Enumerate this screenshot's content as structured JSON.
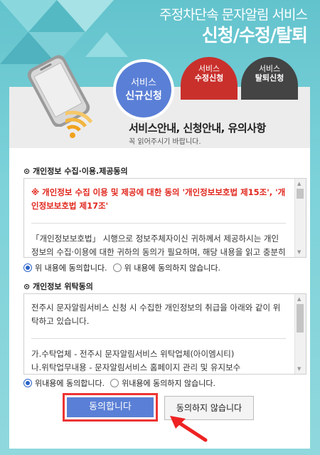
{
  "header": {
    "title1": "주정차단속 문자알림 서비스",
    "title2": "신청/수정/탈퇴"
  },
  "tabs": {
    "new": {
      "line1": "서비스",
      "line2": "신규신청"
    },
    "modify": {
      "line1": "서비스",
      "line2": "수정신청"
    },
    "withdraw": {
      "line1": "서비스",
      "line2": "탈퇴신청"
    }
  },
  "intro": {
    "title": "서비스안내, 신청안내, 유의사항",
    "note": "꼭 읽어주시기 바랍니다."
  },
  "section1": {
    "title": "⊙ 개인정보 수집·이용.제공동의",
    "highlight": "※ 개인정보 수집 이용 및 제공에 대한 동의 '개인정보보호법 제15조', '개인정보보호법 제17조'",
    "body": "「개인정보보호법」 시행으로 정보주체자이신 귀하께서 제공하시는 개인정보의 수집·이용에 대한 귀하의 동의가 필요하며, 해당 내용을 읽고 충분히 숙지하시고 서비스 신청시에 동의 하여 주시",
    "agree": "위 내용에 동의합니다.",
    "disagree": "위 내용에 동의하지 않습니다."
  },
  "section2": {
    "title": "⊙ 개인정보 위탁동의",
    "body1": "전주시 문자알림서비스 신청 시 수집한 개인정보의 취급을 아래와 같이 위탁하고 있습니다.",
    "body2": "가.수탁업체 - 전주시 문자알림서비스 위탁업체(아이엠시티)",
    "body3": "나.위탁업무내용 - 문자알림서비스 홈페이지 관리 및 유지보수",
    "agree": "위내용에 동의합니다.",
    "disagree": "위내용에 동의하지 않습니다."
  },
  "buttons": {
    "agree": "동의합니다",
    "deny": "동의하지 않습니다"
  },
  "colors": {
    "accent": "#5a7fd6",
    "red": "#e0261c",
    "dark": "#444444",
    "bg": "#6fc9d1"
  }
}
